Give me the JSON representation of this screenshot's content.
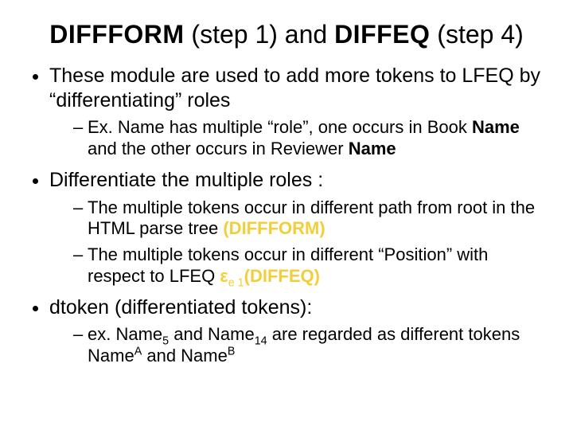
{
  "title": {
    "seg1": "DIFFFORM",
    "seg2": " (step 1) ",
    "seg3": "and",
    "seg4": " ",
    "seg5": "DIFFEQ",
    "seg6": " (step 4)"
  },
  "b1": {
    "line1": "These module are used to add more tokens to LFEQ  by “differentiating” roles",
    "s1a": "Ex. Name has multiple “role”, one occurs in Book ",
    "s1b": "Name",
    "s1c": " and the other occurs in Reviewer ",
    "s1d": "Name"
  },
  "b2": {
    "line1": "Differentiate the multiple roles :",
    "s1a": "The multiple tokens occur in different path from root in the HTML parse tree ",
    "s1b": "(DIFFFORM)",
    "s2a": "The multiple tokens occur in different “Position” with respect to LFEQ ",
    "s2b": "ε",
    "s2sub": "e 1",
    "s2c": "(DIFFEQ)"
  },
  "b3": {
    "line1": "dtoken (differentiated tokens):",
    "s1a": "ex. Name",
    "s1sub1": "5",
    "s1b": " and Name",
    "s1sub2": "14",
    "s1c": " are regarded as different tokens Name",
    "s1sup1": "A",
    "s1d": " and Name",
    "s1sup2": "B"
  }
}
